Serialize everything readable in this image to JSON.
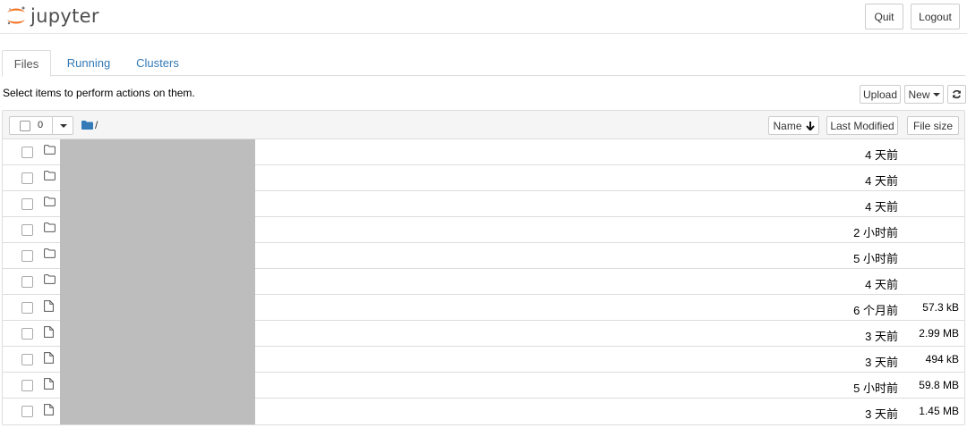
{
  "header": {
    "logo_text": "jupyter",
    "quit_label": "Quit",
    "logout_label": "Logout",
    "brand_color": "#f37626"
  },
  "tabs": [
    {
      "label": "Files",
      "active": true
    },
    {
      "label": "Running",
      "active": false
    },
    {
      "label": "Clusters",
      "active": false
    }
  ],
  "toolbar": {
    "info_text": "Select items to perform actions on them.",
    "upload_label": "Upload",
    "new_label": "New",
    "refresh_icon": "refresh-icon"
  },
  "list_header": {
    "selected_count": "0",
    "path": "/",
    "name_label": "Name",
    "last_modified_label": "Last Modified",
    "file_size_label": "File size"
  },
  "rows": [
    {
      "type": "folder",
      "name": "",
      "modified": "4 天前",
      "size": ""
    },
    {
      "type": "folder",
      "name": "",
      "modified": "4 天前",
      "size": ""
    },
    {
      "type": "folder",
      "name": "",
      "modified": "4 天前",
      "size": ""
    },
    {
      "type": "folder",
      "name": "",
      "modified": "2 小时前",
      "size": ""
    },
    {
      "type": "folder",
      "name": "",
      "modified": "5 小时前",
      "size": ""
    },
    {
      "type": "folder",
      "name": "",
      "modified": "4 天前",
      "size": ""
    },
    {
      "type": "file",
      "name": "",
      "modified": "6 个月前",
      "size": "57.3 kB"
    },
    {
      "type": "file",
      "name": "",
      "modified": "3 天前",
      "size": "2.99 MB"
    },
    {
      "type": "file",
      "name": "",
      "modified": "3 天前",
      "size": "494 kB"
    },
    {
      "type": "file",
      "name": "",
      "modified": "5 小时前",
      "size": "59.8 MB"
    },
    {
      "type": "file",
      "name": "",
      "modified": "3 天前",
      "size": "1.45 MB"
    }
  ]
}
